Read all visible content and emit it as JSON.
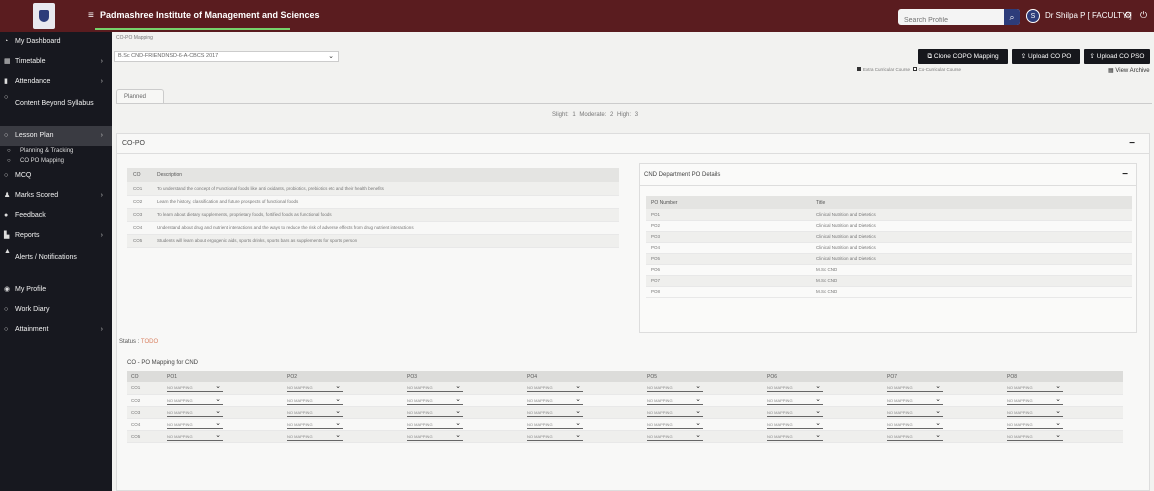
{
  "header": {
    "institute": "Padmashree Institute of Management and Sciences",
    "search_placeholder": "Search Profile",
    "avatar_initial": "S",
    "user": "Dr Shilpa P [ FACULTY ]"
  },
  "sidebar": {
    "items": [
      {
        "label": "My Dashboard",
        "icon": "gauge-icon"
      },
      {
        "label": "Timetable",
        "icon": "calendar-icon",
        "chevron": true
      },
      {
        "label": "Attendance",
        "icon": "bar-chart-icon",
        "chevron": true
      },
      {
        "label": "Content Beyond Syllabus",
        "icon": "circle-icon"
      },
      {
        "label": "Lesson Plan",
        "icon": "circle-icon",
        "chevron": true,
        "active": true
      },
      {
        "label": "MCQ",
        "icon": "circle-icon"
      },
      {
        "label": "Marks Scored",
        "icon": "users-icon",
        "chevron": true
      },
      {
        "label": "Feedback",
        "icon": "comment-icon"
      },
      {
        "label": "Reports",
        "icon": "file-icon",
        "chevron": true
      },
      {
        "label": "Alerts / Notifications",
        "icon": "bell-icon"
      },
      {
        "label": "My Profile",
        "icon": "user-icon"
      },
      {
        "label": "Work Diary",
        "icon": "circle-icon"
      },
      {
        "label": "Attainment",
        "icon": "circle-icon",
        "chevron": true
      }
    ],
    "subitems": [
      "Planning & Tracking",
      "CO PO Mapping"
    ]
  },
  "page": {
    "breadcrumb": "CO-PO Mapping",
    "course": "B.Sc CND-FRIENDNSD-6-A-CBCS 2017",
    "buttons": {
      "clone": "Clone COPO Mapping",
      "upload_co_po": "Upload CO PO",
      "upload_co_pso": "Upload CO PSO"
    },
    "legend": {
      "extra": "Extra Curricular Course",
      "co": "Co-Curricular Course"
    },
    "view_archive": "View Archive",
    "tab": "Planned",
    "levels": "Slight: 1   Moderate: 2   High: 3",
    "panel_title": "CO-PO",
    "co_table": {
      "headers": [
        "CO",
        "Description"
      ],
      "rows": [
        [
          "CO1",
          "To understand the concept of Functional foods like anti oxidants, probiotics, prebiotics etc and their health benefits"
        ],
        [
          "CO2",
          "Learn the history, classification and future prospects of functional foods"
        ],
        [
          "CO3",
          "To learn about dietary supplements, proprietary foods, fortified foods as functional foods"
        ],
        [
          "CO4",
          "Understand about drug and nutrient interactions and the ways to reduce the risk of adverse effects from drug nutrient interactions"
        ],
        [
          "CO5",
          "Students will learn about ergogenic aids, sports drinks, sports bars as supplements for sports person"
        ]
      ]
    },
    "dept": {
      "title": "CND Department PO Details",
      "headers": [
        "PO Number",
        "Title"
      ],
      "rows": [
        [
          "PO1",
          "Clinical Nutrition and Dietetics"
        ],
        [
          "PO2",
          "Clinical Nutrition and Dietetics"
        ],
        [
          "PO3",
          "Clinical Nutrition and Dietetics"
        ],
        [
          "PO4",
          "Clinical Nutrition and Dietetics"
        ],
        [
          "PO5",
          "Clinical Nutrition and Dietetics"
        ],
        [
          "PO6",
          "M.Sc CND"
        ],
        [
          "PO7",
          "M.Sc CND"
        ],
        [
          "PO8",
          "M.Sc CND"
        ]
      ]
    },
    "status_label": "Status :",
    "status_value": "TODO",
    "mapping": {
      "title": "CO - PO Mapping for CND",
      "headers": [
        "CO",
        "PO1",
        "PO2",
        "PO3",
        "PO4",
        "PO5",
        "PO6",
        "PO7",
        "PO8"
      ],
      "rows": [
        "CO1",
        "CO2",
        "CO3",
        "CO4",
        "CO5"
      ],
      "option": "NO MAPPING"
    }
  },
  "colors": {
    "topbar": "#5a1c1f",
    "sidebar": "#17181f",
    "button": "#16171c",
    "status": "#d98060"
  }
}
